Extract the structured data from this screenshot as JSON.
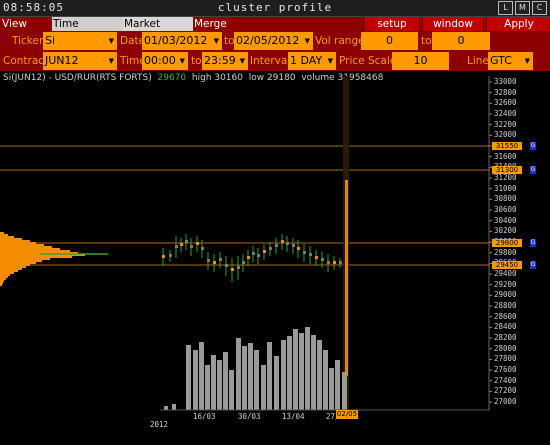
{
  "titlebar": {
    "clock": "08:58:05",
    "title": "cluster profile",
    "buttons": [
      "L",
      "M",
      "C"
    ]
  },
  "menubar": {
    "tabs": [
      "View DOM",
      "Time Interval",
      "Market Watch",
      "Merge Contr"
    ],
    "active_tab": "Time Interval",
    "buttons": [
      "setup",
      "window",
      "Apply"
    ]
  },
  "form": {
    "ticker_label": "Ticker",
    "ticker_value": "Si",
    "date_label": "Date",
    "date_from": "01/03/2012",
    "date_to_label": "to",
    "date_to": "02/05/2012",
    "vol_range_label": "Vol range",
    "vol_from": "0",
    "vol_to_label": "to",
    "vol_to": "0",
    "contract_label": "Contract",
    "contract_value": "JUN12",
    "time_label": "Time",
    "time_from": "00:00",
    "time_to_label": "to",
    "time_to": "23:59",
    "interval_label": "Interval",
    "interval_value": "1 DAY",
    "price_scale_label": "Price Scale",
    "price_scale_value": "10",
    "line_label": "Line",
    "line_value": "GTC"
  },
  "info": {
    "symbol": "Si(JUN12) - USD/RUR(RTS FORTS)",
    "last": "29670",
    "high": "high 30160",
    "low": "low 29180",
    "volume": "volume 31958468"
  },
  "price_axis": [
    "33000",
    "32800",
    "32600",
    "32400",
    "32200",
    "32000",
    "31800",
    "31600",
    "31400",
    "31200",
    "31000",
    "30800",
    "30600",
    "30400",
    "30200",
    "30000",
    "29800",
    "29600",
    "29400",
    "29200",
    "29000",
    "28800",
    "28600",
    "28400",
    "28200",
    "28000",
    "27800",
    "27600",
    "27400",
    "27200",
    "27000"
  ],
  "level_tags": [
    "31550",
    "31300",
    "29800",
    "29450"
  ],
  "level_tag_badge": "G",
  "date_axis": [
    "16/03",
    "30/03",
    "13/04",
    "27/04"
  ],
  "cursor_date": "02/05",
  "year_label": "2012",
  "colors": {
    "background": "#000000",
    "menubar": "#8c0000",
    "accent": "#ff9900",
    "label": "#f0a000",
    "level_line": "#b06a00",
    "volume_bar": "#9a9a9a",
    "candle": "#2fa02f"
  }
}
